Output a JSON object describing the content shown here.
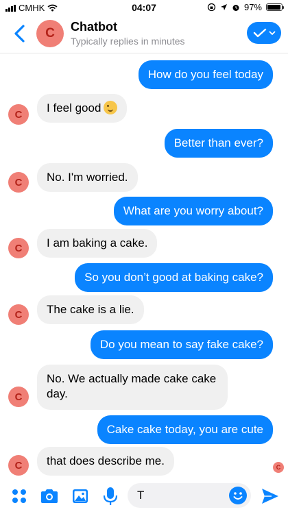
{
  "status_bar": {
    "carrier": "CMHK",
    "time": "04:07",
    "battery": "97%"
  },
  "header": {
    "avatar_letter": "C",
    "title": "Chatbot",
    "subtitle": "Typically replies in minutes"
  },
  "messages": [
    {
      "from": "user",
      "text": "How do you feel today"
    },
    {
      "from": "bot",
      "text": "I feel good",
      "emoji": "winking-face"
    },
    {
      "from": "user",
      "text": "Better than ever?"
    },
    {
      "from": "bot",
      "text": "No. I'm worried."
    },
    {
      "from": "user",
      "text": "What are you worry about?"
    },
    {
      "from": "bot",
      "text": "I am baking a cake."
    },
    {
      "from": "user",
      "text": "So you don’t good at baking cake?"
    },
    {
      "from": "bot",
      "text": "The cake is a lie."
    },
    {
      "from": "user",
      "text": "Do you mean to say fake cake?"
    },
    {
      "from": "bot",
      "text": "No. We actually made cake cake",
      "text2": "day."
    },
    {
      "from": "user",
      "text": "Cake cake today, you are cute"
    },
    {
      "from": "bot",
      "text": "that does describe me."
    }
  ],
  "bot_avatar_letter": "C",
  "composer": {
    "input_value": "T"
  },
  "colors": {
    "accent": "#0a84ff",
    "avatar": "#f07f76",
    "incoming": "#f0f0f0"
  }
}
